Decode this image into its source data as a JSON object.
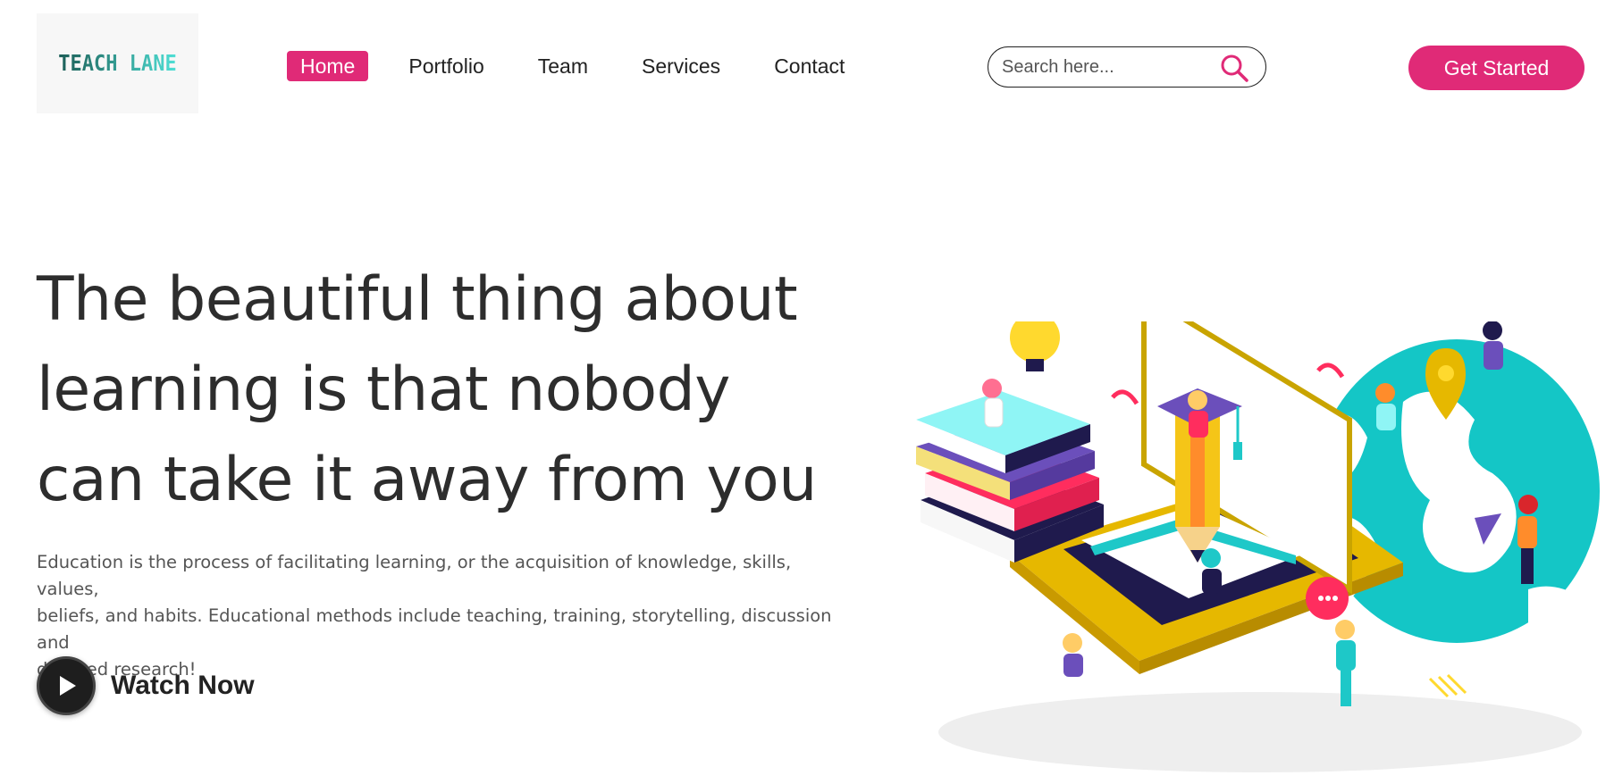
{
  "header": {
    "logo_text": "TEACH LANE",
    "nav": [
      {
        "label": "Home",
        "active": true
      },
      {
        "label": "Portfolio",
        "active": false
      },
      {
        "label": "Team",
        "active": false
      },
      {
        "label": "Services",
        "active": false
      },
      {
        "label": "Contact",
        "active": false
      }
    ],
    "search": {
      "placeholder": "Search here...",
      "value": "",
      "icon": "search-icon"
    },
    "cta_label": "Get Started"
  },
  "hero": {
    "title_lines": [
      "The beautiful thing about",
      "learning is that nobody",
      "can take it away from you"
    ],
    "description_lines": [
      "Education is the process of facilitating learning, or the acquisition of knowledge, skills, values,",
      "beliefs, and habits. Educational methods include teaching, training, storytelling, discussion and",
      "directed research!"
    ],
    "watch_label": "Watch Now",
    "watch_icon": "play-icon"
  },
  "colors": {
    "accent": "#e02a77",
    "text_dark": "#2d2d2d",
    "text_muted": "#555555",
    "teal": "#1ec8c8",
    "yellow": "#f5c518",
    "navy": "#1f1a4d",
    "purple": "#6b4fbb"
  }
}
